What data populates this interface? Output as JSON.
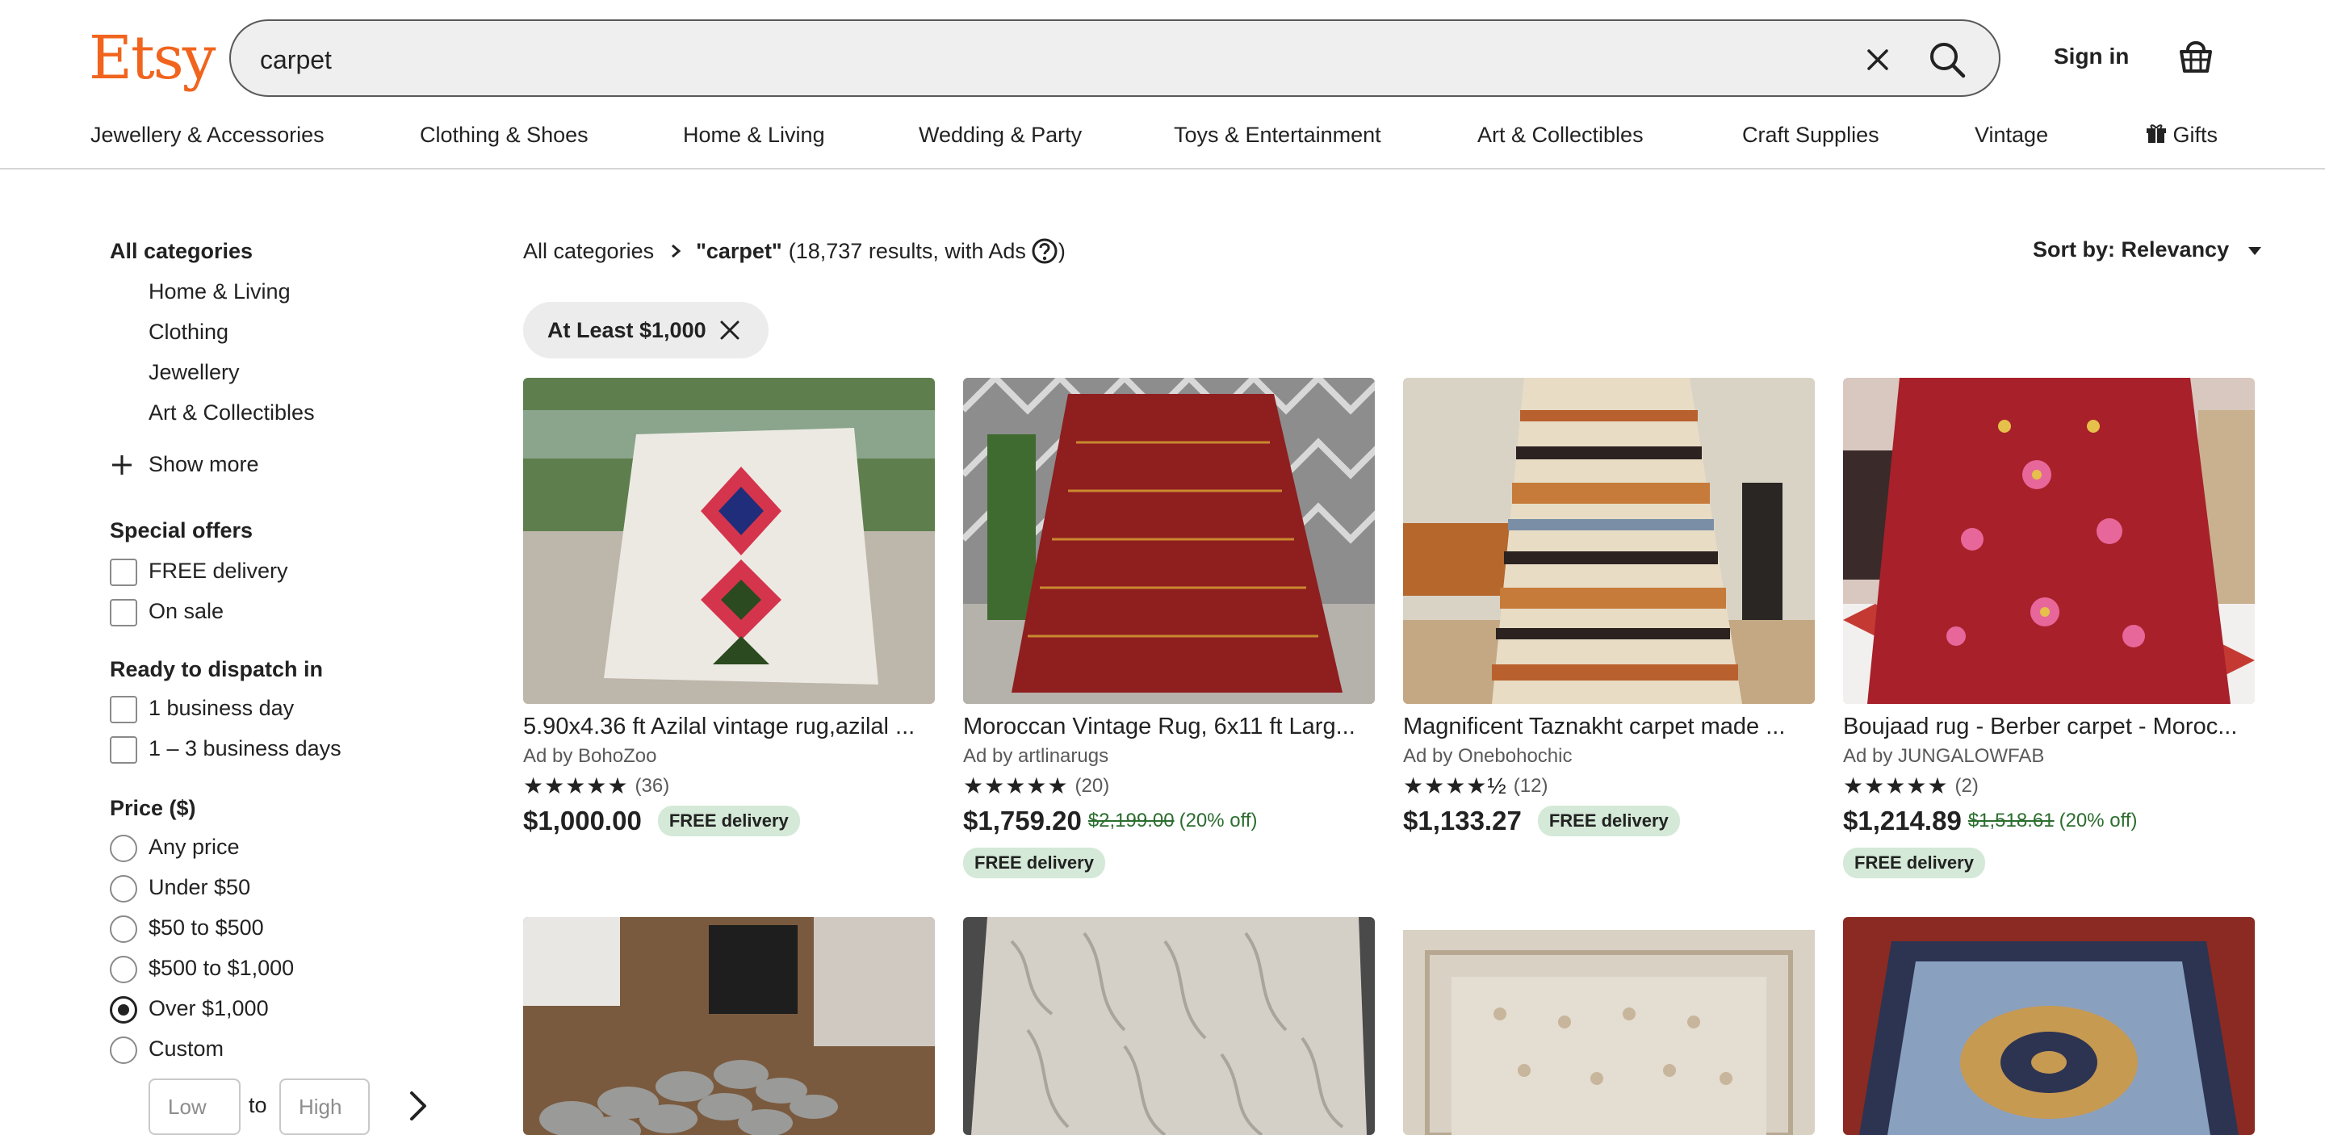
{
  "header": {
    "logo": "Etsy",
    "search_value": "carpet",
    "sign_in": "Sign in"
  },
  "nav": [
    "Jewellery & Accessories",
    "Clothing & Shoes",
    "Home & Living",
    "Wedding & Party",
    "Toys & Entertainment",
    "Art & Collectibles",
    "Craft Supplies",
    "Vintage",
    "Gifts"
  ],
  "sidebar": {
    "categories_title": "All categories",
    "categories": [
      "Home & Living",
      "Clothing",
      "Jewellery",
      "Art & Collectibles"
    ],
    "show_more": "Show more",
    "special_offers_title": "Special offers",
    "special_offers": [
      "FREE delivery",
      "On sale"
    ],
    "dispatch_title": "Ready to dispatch in",
    "dispatch": [
      "1 business day",
      "1 – 3 business days"
    ],
    "price_title": "Price ($)",
    "price_options": [
      "Any price",
      "Under $50",
      "$50 to $500",
      "$500 to $1,000",
      "Over $1,000",
      "Custom"
    ],
    "price_selected": "Over $1,000",
    "low_placeholder": "Low",
    "to_label": "to",
    "high_placeholder": "High"
  },
  "results": {
    "breadcrumb_root": "All categories",
    "query": "\"carpet\"",
    "count_text": "(18,737 results, with Ads",
    "close_paren": ")",
    "sort_label": "Sort by: Relevancy",
    "filter_chip": "At Least $1,000"
  },
  "listings": [
    {
      "title": "5.90x4.36 ft Azilal vintage rug,azilal ...",
      "seller": "Ad by BohoZoo",
      "stars": "★★★★★",
      "count": "(36)",
      "price": "$1,000.00",
      "original": "",
      "discount": "",
      "badge": "FREE delivery"
    },
    {
      "title": "Moroccan Vintage Rug, 6x11 ft Larg...",
      "seller": "Ad by artlinarugs",
      "stars": "★★★★★",
      "count": "(20)",
      "price": "$1,759.20",
      "original": "$2,199.00",
      "discount": "(20% off)",
      "badge": "FREE delivery"
    },
    {
      "title": "Magnificent Taznakht carpet made ...",
      "seller": "Ad by Onebohochic",
      "stars": "★★★★½",
      "count": "(12)",
      "price": "$1,133.27",
      "original": "",
      "discount": "",
      "badge": "FREE delivery"
    },
    {
      "title": "Boujaad rug - Berber carpet - Moroc...",
      "seller": "Ad by JUNGALOWFAB",
      "stars": "★★★★★",
      "count": "(2)",
      "price": "$1,214.89",
      "original": "$1,518.61",
      "discount": "(20% off)",
      "badge": "FREE delivery"
    }
  ],
  "colors": {
    "brand": "#F1641E",
    "badge_bg": "#D4E9D7",
    "sale_text": "#2C6E2F"
  }
}
